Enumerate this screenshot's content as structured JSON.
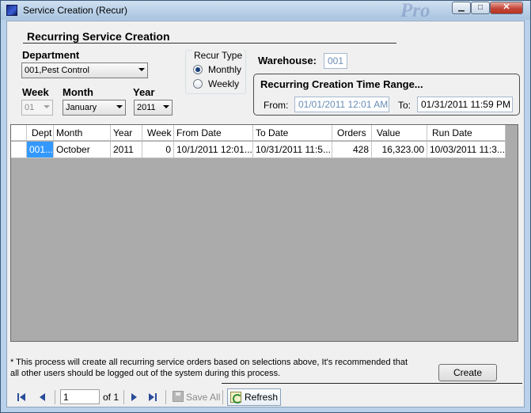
{
  "window": {
    "title": "Service Creation (Recur)",
    "brand_watermark": "Pro",
    "min_symbol": "▁",
    "max_symbol": "□",
    "close_symbol": "✕"
  },
  "form": {
    "section_title": "Recurring Service Creation",
    "department": {
      "label": "Department",
      "value": "001,Pest Control"
    },
    "week": {
      "label": "Week",
      "value": "01"
    },
    "month": {
      "label": "Month",
      "value": "January"
    },
    "year": {
      "label": "Year",
      "value": "2011"
    },
    "recur_type": {
      "title": "Recur Type",
      "options": [
        {
          "label": "Monthly",
          "checked": true
        },
        {
          "label": "Weekly",
          "checked": false
        }
      ]
    },
    "warehouse": {
      "label": "Warehouse:",
      "value": "001"
    },
    "time_range": {
      "title": "Recurring Creation Time Range...",
      "from_label": "From:",
      "from_value": "01/01/2011 12:01 AM",
      "to_label": "To:",
      "to_value": "01/31/2011 11:59 PM"
    }
  },
  "grid": {
    "columns": [
      "Dept",
      "Month",
      "Year",
      "Week",
      "From Date",
      "To Date",
      "Orders",
      "Value",
      "Run Date"
    ],
    "rows": [
      [
        "001...",
        "October",
        "2011",
        "0",
        "10/1/2011 12:01...",
        "10/31/2011 11:5...",
        "428",
        "16,323.00",
        "10/03/2011 11:3..."
      ]
    ]
  },
  "footer": {
    "note": "* This process will create all recurring service orders based on selections above, It's recommended that all other users should be logged out of the system during this process.",
    "create_label": "Create"
  },
  "toolbar": {
    "page_value": "1",
    "of_label": "of 1",
    "save_all_label": "Save All",
    "refresh_label": "Refresh"
  },
  "colors": {
    "selection": "#3399ff",
    "grid_background": "#ababab",
    "window_frame": "#b9d1ea"
  }
}
